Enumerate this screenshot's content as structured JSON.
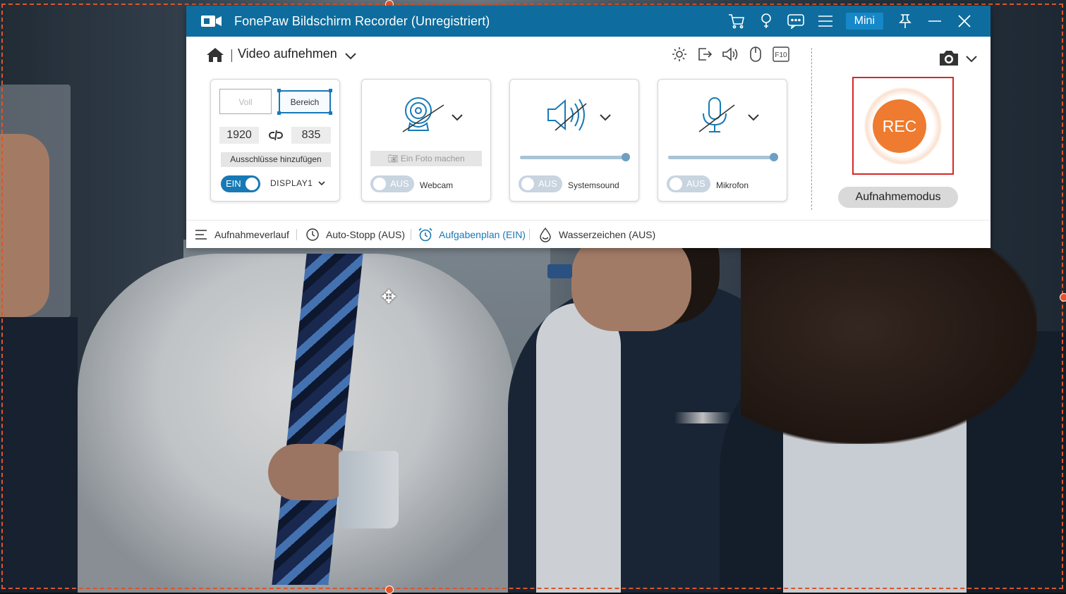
{
  "window": {
    "title": "FonePaw Bildschirm Recorder (Unregistriert)",
    "mini_label": "Mini",
    "title_icons": [
      "cart-icon",
      "bulb-icon",
      "chat-icon",
      "menu-icon",
      "pin-icon",
      "minimize-icon",
      "close-icon"
    ]
  },
  "mode": {
    "label": "Video aufnehmen"
  },
  "tools": [
    "gear-icon",
    "export-icon",
    "speaker-icon",
    "mouse-icon",
    "f10-hotkey-icon"
  ],
  "tools_f10_label": "F10",
  "area": {
    "full_label": "Voll",
    "region_label": "Bereich",
    "width": "1920",
    "height": "835",
    "exclusions_label": "Ausschlüsse hinzufügen",
    "toggle_label": "EIN",
    "display_label": "DISPLAY1"
  },
  "webcam": {
    "photo_label": "Ein Foto machen",
    "toggle_label": "AUS",
    "label": "Webcam"
  },
  "systemsound": {
    "toggle_label": "AUS",
    "label": "Systemsound",
    "volume": 1.0
  },
  "microphone": {
    "toggle_label": "AUS",
    "label": "Mikrofon",
    "volume": 1.0
  },
  "rec": {
    "label": "REC",
    "mode_label": "Aufnahmemodus"
  },
  "bottom": {
    "history": "Aufnahmeverlauf",
    "autostop": "Auto-Stopp (AUS)",
    "schedule": "Aufgabenplan (EIN)",
    "watermark": "Wasserzeichen (AUS)"
  },
  "colors": {
    "titlebar": "#0e6d9e",
    "accent": "#1779b6",
    "rec": "#ee7b2f",
    "selection": "#d9572b"
  }
}
